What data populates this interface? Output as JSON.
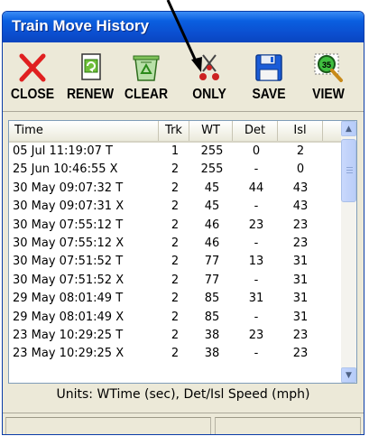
{
  "window": {
    "title": "Train Move History"
  },
  "toolbar": {
    "buttons": [
      {
        "label": "CLOSE",
        "icon": "close-icon"
      },
      {
        "label": "RENEW",
        "icon": "renew-icon"
      },
      {
        "label": "CLEAR",
        "icon": "clear-recycle-icon"
      },
      {
        "label": "ONLY",
        "icon": "only-filter-icon"
      },
      {
        "label": "SAVE",
        "icon": "save-floppy-icon"
      },
      {
        "label": "VIEW",
        "icon": "view-magnifier-icon"
      }
    ]
  },
  "columns": [
    "Time",
    "Trk",
    "WT",
    "Det",
    "Isl"
  ],
  "rows": [
    {
      "time": "05 Jul 11:19:07 T",
      "trk": "1",
      "wt": "255",
      "det": "0",
      "isl": "2"
    },
    {
      "time": "25 Jun 10:46:55 X",
      "trk": "2",
      "wt": "255",
      "det": "-",
      "isl": "0"
    },
    {
      "time": "30 May 09:07:32 T",
      "trk": "2",
      "wt": "45",
      "det": "44",
      "isl": "43"
    },
    {
      "time": "30 May 09:07:31 X",
      "trk": "2",
      "wt": "45",
      "det": "-",
      "isl": "43"
    },
    {
      "time": "30 May 07:55:12 T",
      "trk": "2",
      "wt": "46",
      "det": "23",
      "isl": "23"
    },
    {
      "time": "30 May 07:55:12 X",
      "trk": "2",
      "wt": "46",
      "det": "-",
      "isl": "23"
    },
    {
      "time": "30 May 07:51:52 T",
      "trk": "2",
      "wt": "77",
      "det": "13",
      "isl": "31"
    },
    {
      "time": "30 May 07:51:52 X",
      "trk": "2",
      "wt": "77",
      "det": "-",
      "isl": "31"
    },
    {
      "time": "29 May 08:01:49 T",
      "trk": "2",
      "wt": "85",
      "det": "31",
      "isl": "31"
    },
    {
      "time": "29 May 08:01:49 X",
      "trk": "2",
      "wt": "85",
      "det": "-",
      "isl": "31"
    },
    {
      "time": "23 May 10:29:25 T",
      "trk": "2",
      "wt": "38",
      "det": "23",
      "isl": "23"
    },
    {
      "time": "23 May 10:29:25 X",
      "trk": "2",
      "wt": "38",
      "det": "-",
      "isl": "23"
    }
  ],
  "units_text": "Units:   WTime (sec),  Det/Isl Speed (mph)",
  "colors": {
    "titlebar": "#0b4fd0",
    "close_red": "#e02020",
    "save_blue": "#1a5cd8"
  }
}
